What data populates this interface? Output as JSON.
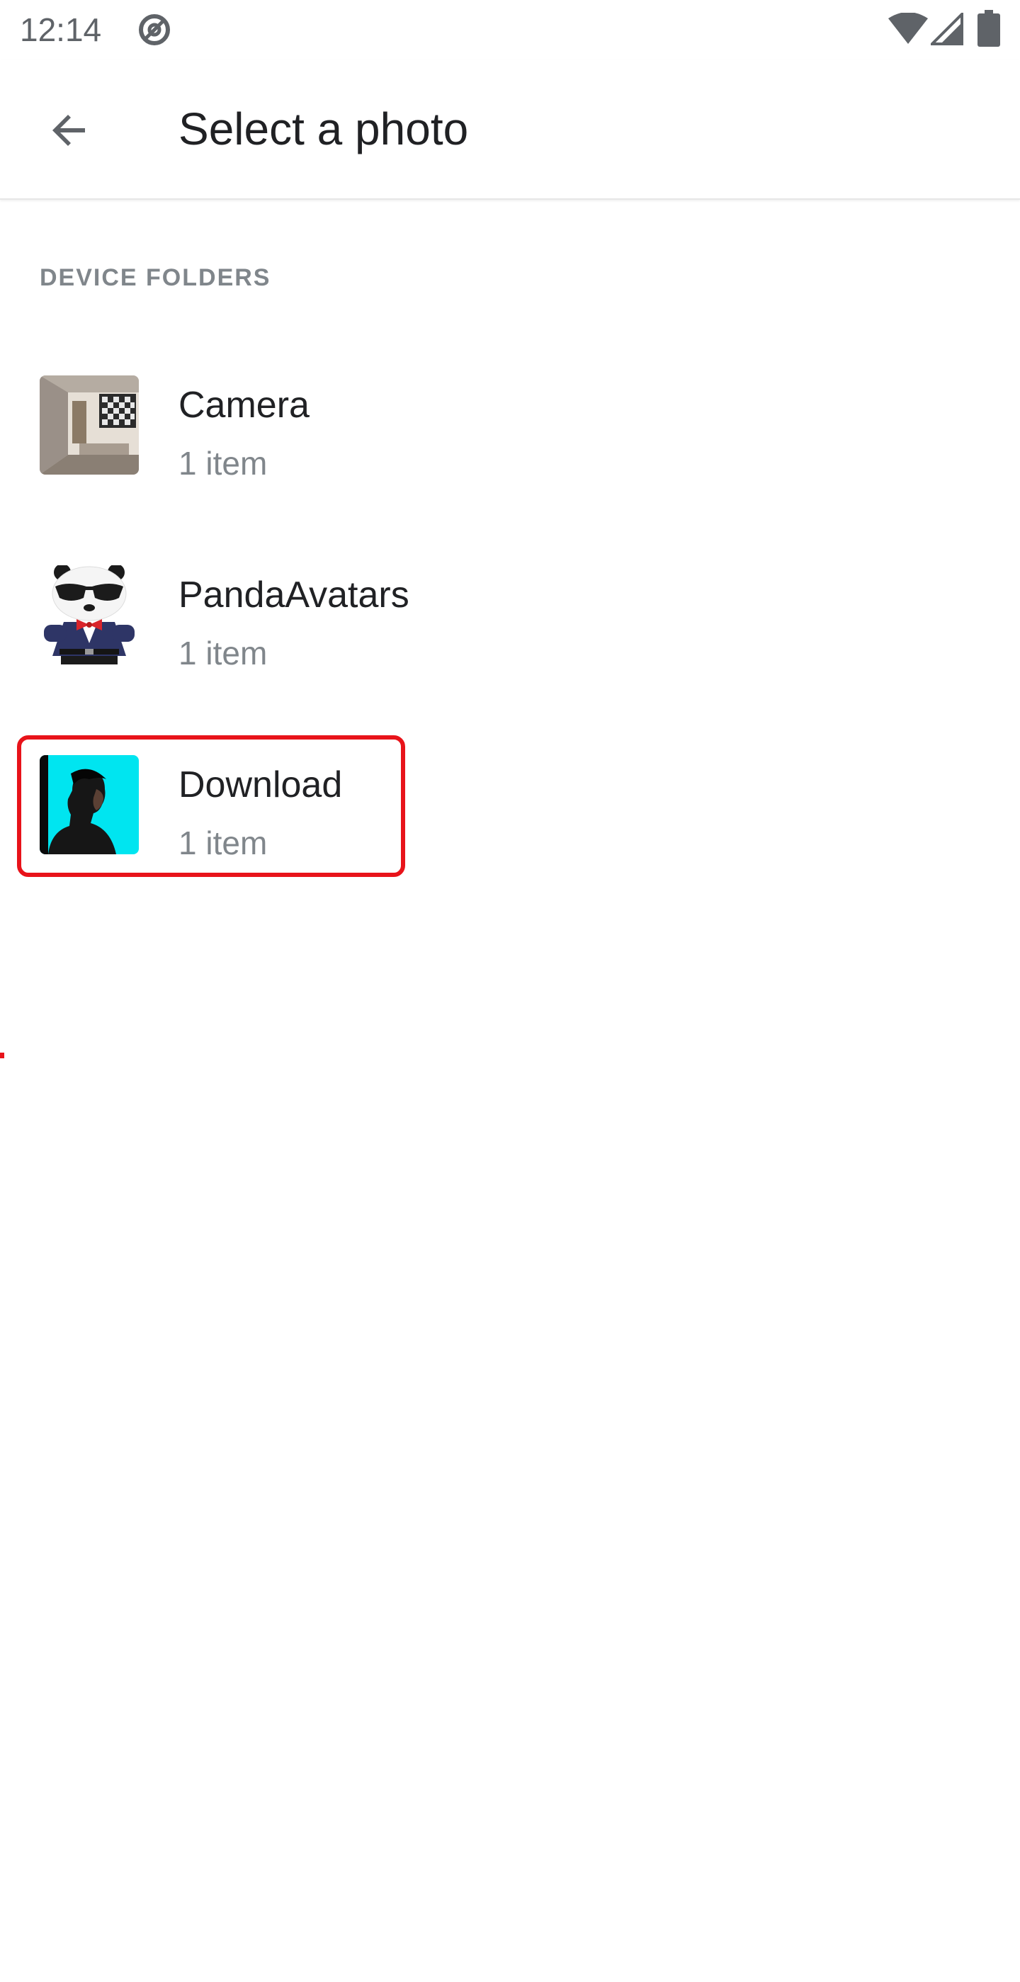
{
  "status_bar": {
    "time": "12:14",
    "icons": [
      "no-disturb-icon",
      "wifi-icon",
      "cell-signal-icon",
      "battery-icon"
    ]
  },
  "app_bar": {
    "back_icon": "arrow-back-icon",
    "title": "Select a photo"
  },
  "section": {
    "header": "DEVICE FOLDERS"
  },
  "folders": [
    {
      "name": "Camera",
      "count": "1 item",
      "thumbnail": "room-interior-photo"
    },
    {
      "name": "PandaAvatars",
      "count": "1 item",
      "thumbnail": "panda-avatar-illustration"
    },
    {
      "name": "Download",
      "count": "1 item",
      "thumbnail": "man-profile-cyan-photo",
      "highlighted": true
    }
  ],
  "colors": {
    "title_text": "#202124",
    "secondary_text": "#80868b",
    "highlight": "#e8131a",
    "download_thumb_bg": "#00e5f0"
  }
}
